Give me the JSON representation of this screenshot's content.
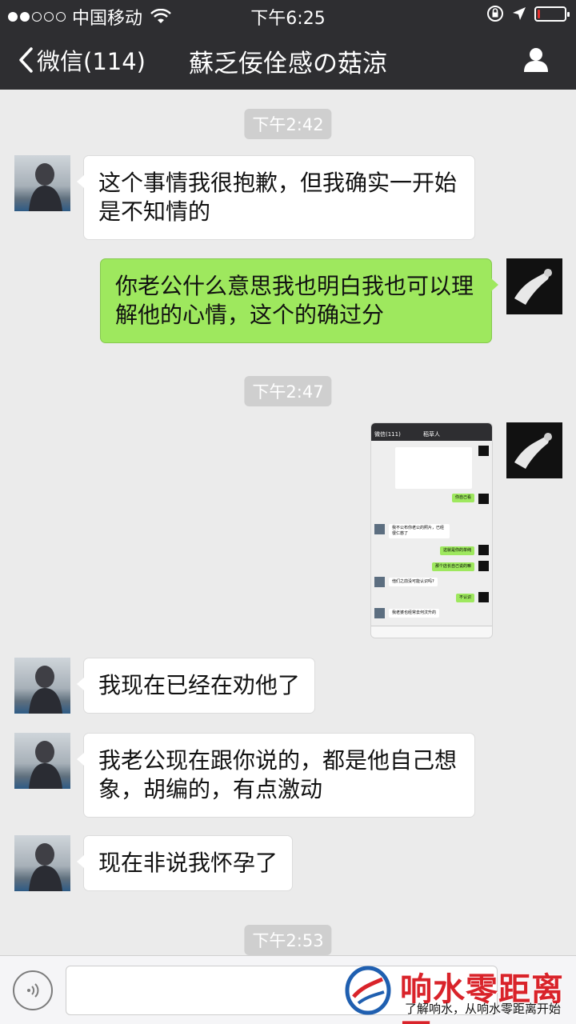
{
  "status_bar": {
    "carrier": "中国移动",
    "time": "下午6:25",
    "signal_bars_filled": 2,
    "signal_bars_total": 5,
    "battery_level": 0.1,
    "battery_color": "#e5312f"
  },
  "nav": {
    "back_label": "微信(114)",
    "title": "蘇乏佞佺感の菇涼"
  },
  "messages": [
    {
      "type": "timestamp",
      "text": "下午2:42"
    },
    {
      "type": "text",
      "side": "left",
      "lines": [
        "这个事情我很抱歉，但我确实一开始",
        "是不知情的"
      ]
    },
    {
      "type": "text",
      "side": "right",
      "lines": [
        "你老公什么意思我也明白我也可以理",
        "解他的心情，这个的确过分"
      ]
    },
    {
      "type": "timestamp",
      "text": "下午2:47"
    },
    {
      "type": "image",
      "side": "right"
    },
    {
      "type": "text",
      "side": "left",
      "lines": [
        "我现在已经在劝他了"
      ]
    },
    {
      "type": "text",
      "side": "left",
      "lines": [
        "我老公现在跟你说的，都是他自己想",
        "象，胡编的，有点激动"
      ]
    },
    {
      "type": "text",
      "side": "left",
      "lines": [
        "现在非说我怀孕了"
      ]
    },
    {
      "type": "timestamp",
      "text": "下午2:53"
    }
  ],
  "nested_screenshot": {
    "back_label": "微信(111)",
    "title": "稻草人",
    "rows": [
      "你自己看",
      "我不公布你老公的照片，已经很仁慈了",
      "这就是你的单纯",
      "那个店长自己说的嘛",
      "他们之前没可能认识吗?",
      "不认识",
      "我老婆也经常去何汶升的"
    ]
  },
  "watermark": {
    "title": "响水零距离网",
    "subtitle": "了解响水，从响水零距离开始",
    "color": "#d9232a"
  },
  "colors": {
    "bar_bg": "#2e2e31",
    "chat_bg": "#ebebeb",
    "bubble_self": "#9ee85e",
    "bubble_other": "#ffffff"
  }
}
